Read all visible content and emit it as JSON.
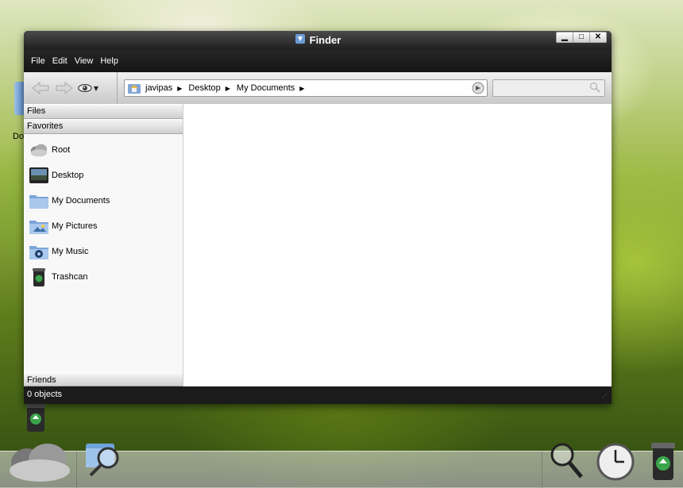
{
  "window": {
    "title": "Finder",
    "controls": {
      "minimize": "▁",
      "maximize": "□",
      "close": "✕"
    }
  },
  "menu": [
    "File",
    "Edit",
    "View",
    "Help"
  ],
  "path": [
    "javipas",
    "Desktop",
    "My Documents"
  ],
  "search": {
    "placeholder": ""
  },
  "sidebar": {
    "files_header": "Files",
    "favorites_header": "Favorites",
    "friends_header": "Friends",
    "items": [
      {
        "label": "Root",
        "icon": "cloud-icon"
      },
      {
        "label": "Desktop",
        "icon": "desktop-icon"
      },
      {
        "label": "My Documents",
        "icon": "folder-icon"
      },
      {
        "label": "My Pictures",
        "icon": "pictures-folder-icon"
      },
      {
        "label": "My Music",
        "icon": "music-folder-icon"
      },
      {
        "label": "Trashcan",
        "icon": "trash-icon"
      }
    ]
  },
  "status": {
    "text": "0 objects"
  },
  "desktop": {
    "partial_label": "Do"
  },
  "dock": [
    "cloud-icon",
    "finder-search-icon",
    "search-icon",
    "clock-icon",
    "trash-icon"
  ]
}
